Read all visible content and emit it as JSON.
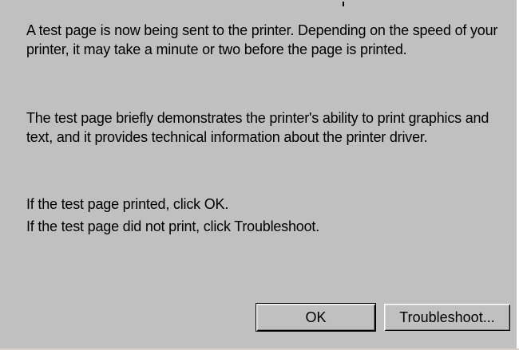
{
  "dialog": {
    "paragraph_1": "A test page is now being sent to the printer. Depending on the speed of your printer, it may take a minute or two before the page is printed.",
    "paragraph_2": "The test page briefly demonstrates the printer's ability to print graphics and text, and it provides technical information about the printer driver.",
    "line_ok": "If the test page printed, click OK.",
    "line_troubleshoot": "If the test page did not print, click Troubleshoot."
  },
  "buttons": {
    "ok_label": "OK",
    "troubleshoot_label": "Troubleshoot..."
  },
  "colors": {
    "dialog_background": "#c0c0c0",
    "text": "#000000"
  }
}
